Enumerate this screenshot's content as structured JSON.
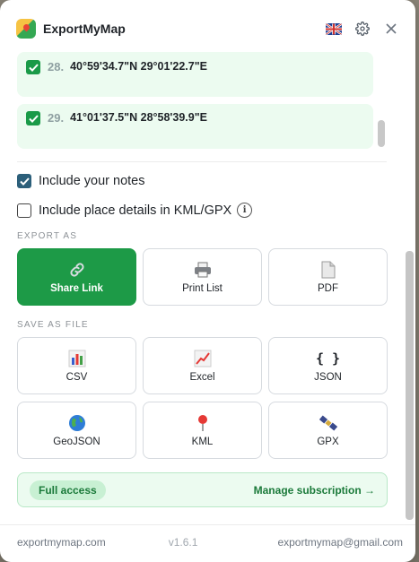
{
  "header": {
    "title": "ExportMyMap",
    "language_flag": "uk-flag-icon",
    "settings_icon": "gear-icon",
    "close_icon": "close-icon"
  },
  "locations": [
    {
      "number": "28.",
      "coords": "40°59'34.7\"N 29°01'22.7\"E",
      "checked": true
    },
    {
      "number": "29.",
      "coords": "41°01'37.5\"N 28°58'39.9\"E",
      "checked": true
    }
  ],
  "options": {
    "include_notes": {
      "label": "Include your notes",
      "checked": true
    },
    "include_place_details": {
      "label": "Include place details in KML/GPX",
      "checked": false
    }
  },
  "export_as": {
    "label": "EXPORT AS",
    "buttons": [
      {
        "label": "Share Link",
        "icon": "link-icon"
      },
      {
        "label": "Print List",
        "icon": "printer-icon"
      },
      {
        "label": "PDF",
        "icon": "document-icon"
      }
    ]
  },
  "save_as_file": {
    "label": "SAVE AS FILE",
    "buttons": [
      {
        "label": "CSV",
        "icon": "bar-chart-icon"
      },
      {
        "label": "Excel",
        "icon": "line-chart-icon"
      },
      {
        "label": "JSON",
        "icon": "braces-icon"
      },
      {
        "label": "GeoJSON",
        "icon": "globe-icon"
      },
      {
        "label": "KML",
        "icon": "pin-icon"
      },
      {
        "label": "GPX",
        "icon": "satellite-icon"
      }
    ]
  },
  "subscription": {
    "badge": "Full access",
    "manage_label": "Manage subscription →"
  },
  "footer": {
    "site": "exportmymap.com",
    "version": "v1.6.1",
    "email": "exportmymap@gmail.com"
  },
  "colors": {
    "primary_green": "#1d9a47",
    "light_green": "#ecfbf0"
  }
}
